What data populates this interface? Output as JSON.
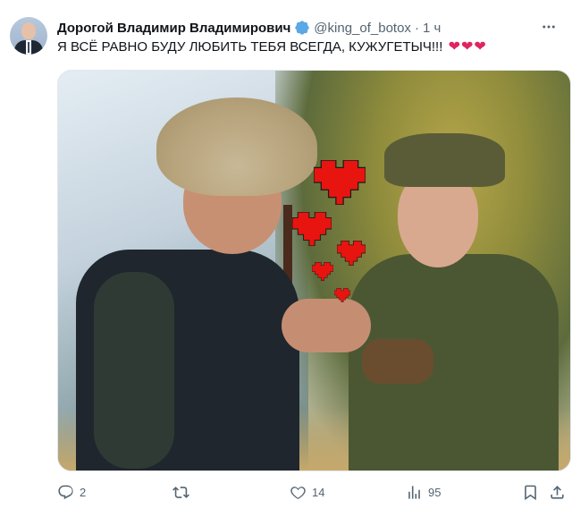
{
  "author": {
    "display_name": "Дорогой Владимир Владимирович",
    "handle": "@king_of_botox",
    "separator": "·",
    "time": "1 ч"
  },
  "tweet": {
    "text": "Я ВСЁ РАВНО БУДУ ЛЮБИТЬ ТЕБЯ ВСЕГДА, КУЖУГЕТЫЧ!!!",
    "emoji": "❤❤❤"
  },
  "actions": {
    "replies": "2",
    "retweets": "",
    "likes": "14",
    "views": "95"
  },
  "colors": {
    "verified": "#5aa8e6",
    "muted": "#536471",
    "heart": "#e0245e",
    "pixel_heart": "#e8140f"
  },
  "icons": [
    "verified-icon",
    "more-icon",
    "reply-icon",
    "retweet-icon",
    "like-icon",
    "views-icon",
    "bookmark-icon",
    "share-icon"
  ]
}
